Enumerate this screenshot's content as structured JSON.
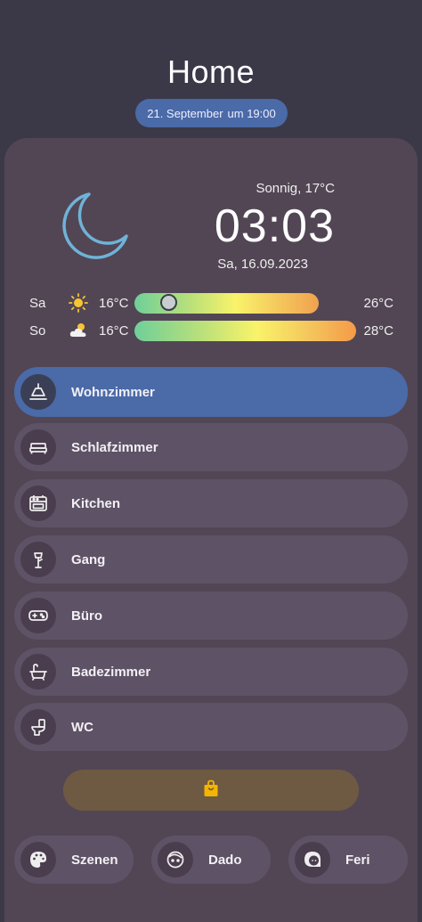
{
  "header": {
    "title": "Home",
    "date_pill": {
      "date": "21. September",
      "time": "um 19:00"
    }
  },
  "weather": {
    "now": "Sonnig, 17°C",
    "clock": "03:03",
    "date": "Sa, 16.09.2023",
    "icon": "moon-icon",
    "forecast": [
      {
        "day": "Sa",
        "icon": "sun-icon",
        "min": "16°C",
        "max": "26°C",
        "current_position": 0.14
      },
      {
        "day": "So",
        "icon": "partly-cloudy-icon",
        "min": "16°C",
        "max": "28°C"
      }
    ]
  },
  "rooms": [
    {
      "label": "Wohnzimmer",
      "icon": "ceiling-lamp-icon",
      "active": true
    },
    {
      "label": "Schlafzimmer",
      "icon": "bed-icon"
    },
    {
      "label": "Kitchen",
      "icon": "oven-icon"
    },
    {
      "label": "Gang",
      "icon": "floor-lamp-icon"
    },
    {
      "label": "Büro",
      "icon": "gamepad-icon"
    },
    {
      "label": "Badezimmer",
      "icon": "bathtub-icon"
    },
    {
      "label": "WC",
      "icon": "toilet-icon"
    }
  ],
  "lock_button": {
    "icon": "shopping-bag-icon",
    "color": "#f5b400"
  },
  "bottom": [
    {
      "label": "Szenen",
      "icon": "palette-icon"
    },
    {
      "label": "Dado",
      "icon": "face-icon"
    },
    {
      "label": "Feri",
      "icon": "face-woman-icon"
    }
  ],
  "colors": {
    "accent": "#4a6aa8",
    "background": "#3b3848",
    "card": "#524655",
    "item": "#5e5266",
    "moon": "#6fb3d8"
  }
}
